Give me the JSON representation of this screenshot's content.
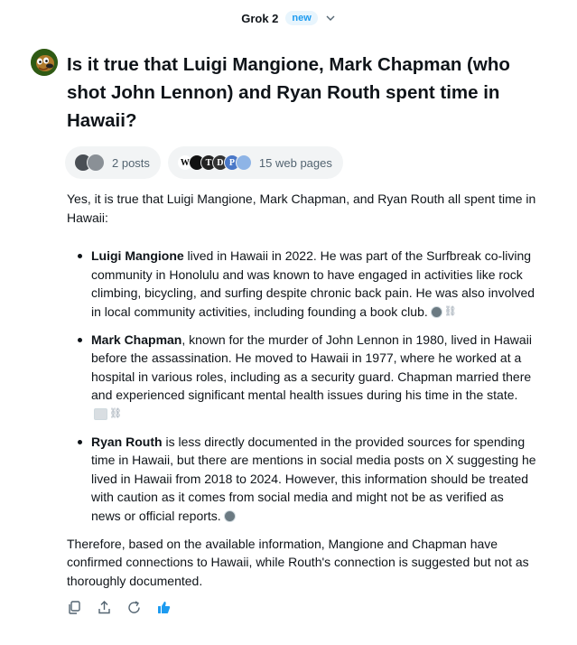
{
  "header": {
    "model_name": "Grok 2",
    "badge": "new"
  },
  "question": "Is it true that Luigi Mangione, Mark Chapman (who shot John Lennon) and Ryan Routh spent time in Hawaii?",
  "sources": {
    "posts_label": "2 posts",
    "web_label": "15 web pages",
    "site_glyphs": [
      "W",
      "",
      "T",
      "D",
      "P",
      ""
    ]
  },
  "answer": {
    "intro": "Yes, it is true that Luigi Mangione, Mark Chapman, and Ryan Routh all spent time in Hawaii:",
    "points": [
      {
        "name": "Luigi Mangione",
        "text": " lived in Hawaii in 2022. He was part of the Surfbreak co-living community in Honolulu and was known to have engaged in activities like rock climbing, bicycling, and surfing despite chronic back pain. He was also involved in local community activities, including founding a book club."
      },
      {
        "name": "Mark Chapman",
        "text": ", known for the murder of John Lennon in 1980, lived in Hawaii before the assassination. He moved to Hawaii in 1977, where he worked at a hospital in various roles, including as a security guard. Chapman married there and experienced significant mental health issues during his time in the state."
      },
      {
        "name": "Ryan Routh",
        "text": " is less directly documented in the provided sources for spending time in Hawaii, but there are mentions in social media posts on X suggesting he lived in Hawaii from 2018 to 2024. However, this information should be treated with caution as it comes from social media and might not be as verified as news or official reports."
      }
    ],
    "conclusion": "Therefore, based on the available information, Mangione and Chapman have confirmed connections to Hawaii, while Routh's connection is suggested but not as thoroughly documented."
  },
  "colors": {
    "accent": "#1d9bf0",
    "text": "#0f1419",
    "muted": "#536471",
    "chip_bg": "#f2f4f5"
  },
  "actions": [
    "copy-icon",
    "share-icon",
    "regenerate-icon",
    "thumbs-up-icon"
  ]
}
